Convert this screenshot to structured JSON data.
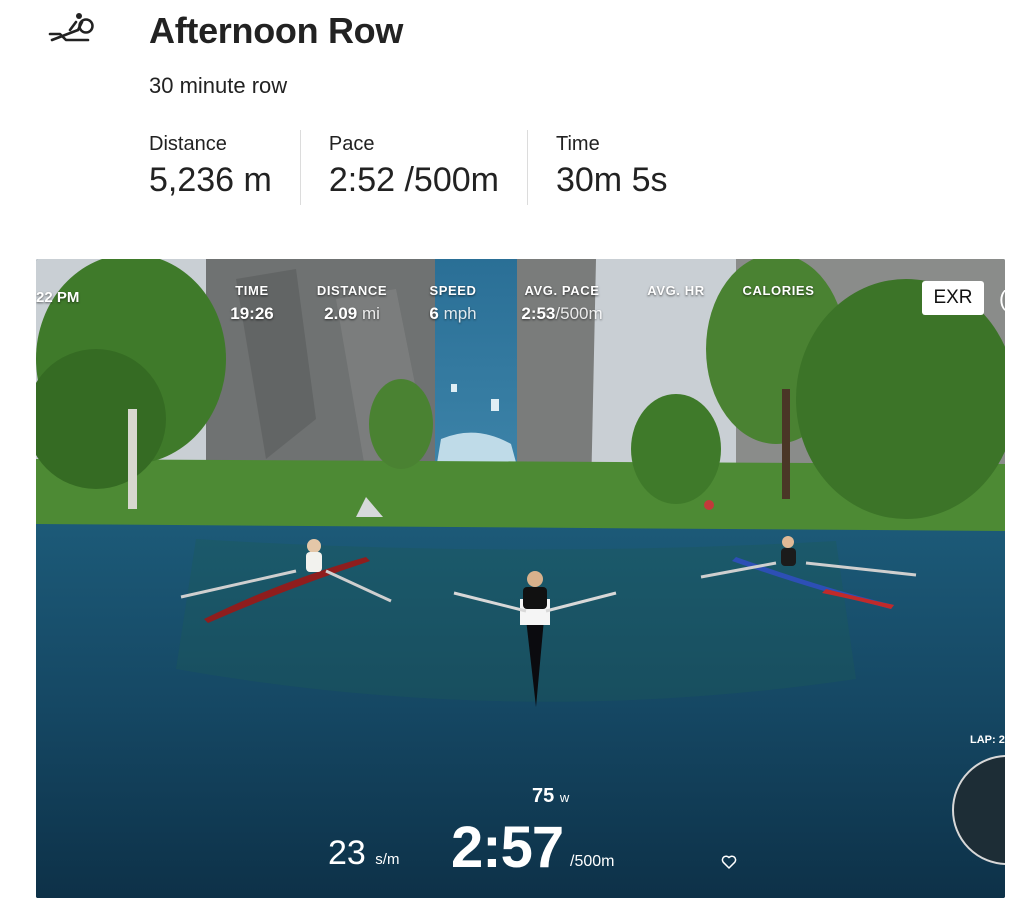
{
  "workout": {
    "icon": "rowing-machine-icon",
    "title": "Afternoon Row",
    "subtitle": "30 minute row"
  },
  "stats": [
    {
      "label": "Distance",
      "value": "5,236 m"
    },
    {
      "label": "Pace",
      "value": "2:52 /500m"
    },
    {
      "label": "Time",
      "value": "30m 5s"
    }
  ],
  "video": {
    "clock": "22 PM",
    "metrics": [
      {
        "label": "TIME",
        "value": "19:26",
        "unit": ""
      },
      {
        "label": "DISTANCE",
        "value": "2.09",
        "unit": "mi"
      },
      {
        "label": "SPEED",
        "value": "6",
        "unit": "mph"
      },
      {
        "label": "AVG. PACE",
        "value": "2:53",
        "unit": "/500m"
      },
      {
        "label": "AVG. HR",
        "value": "",
        "unit": ""
      },
      {
        "label": "CALORIES",
        "value": "",
        "unit": ""
      }
    ],
    "brand_button": "EXR",
    "watts": {
      "value": "75",
      "unit": "w"
    },
    "stroke_rate": {
      "value": "23",
      "unit": "s/m"
    },
    "pace": {
      "value": "2:57",
      "unit": "/500m"
    },
    "lap_label": "LAP: 2",
    "colors": {
      "water": "#154763",
      "sky": "#c9cfd4",
      "foliage": "#3f7a2a"
    }
  }
}
